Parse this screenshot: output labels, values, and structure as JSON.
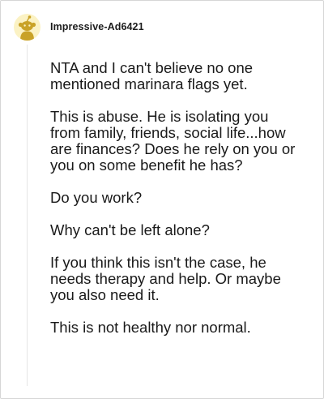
{
  "comment": {
    "author": "Impressive-Ad6421",
    "avatar_icon": "snoo-avatar-icon",
    "paragraphs": [
      "NTA and I can't believe no one mentioned marinara flags yet.",
      "This is abuse. He is isolating you from family, friends, social life...how are finances? Does he rely on you or you on some benefit he has?",
      "Do you work?",
      "Why can't be left alone?",
      "If you think this isn't the case, he needs therapy and help. Or maybe you also need it.",
      "This is not healthy nor normal."
    ]
  },
  "colors": {
    "avatar_background": "#fbf2c4",
    "avatar_figure": "#c9a227",
    "text": "#1a1a1a",
    "thread_line": "#e5e5e5"
  }
}
